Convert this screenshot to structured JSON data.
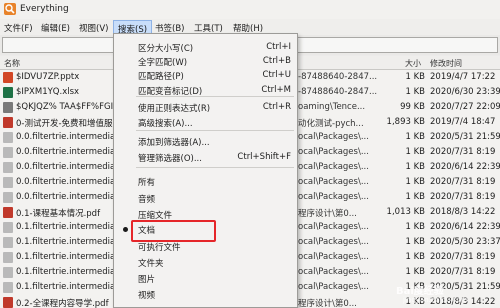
{
  "window": {
    "title": "Everything"
  },
  "menubar": [
    {
      "id": "file",
      "label": "文件(F)"
    },
    {
      "id": "edit",
      "label": "编辑(E)"
    },
    {
      "id": "view",
      "label": "视图(V)"
    },
    {
      "id": "search",
      "label": "搜索(S)"
    },
    {
      "id": "bookmarks",
      "label": "书签(B)"
    },
    {
      "id": "tools",
      "label": "工具(T)"
    },
    {
      "id": "help",
      "label": "帮助(H)"
    }
  ],
  "search": {
    "value": "",
    "placeholder": ""
  },
  "columns": {
    "name": "名称",
    "size": "大小",
    "modified": "修改时间"
  },
  "files": [
    {
      "name": "$IDVU7ZP.pptx",
      "path": "-87488640-2847...",
      "size": "1 KB",
      "date": "2019/4/7 17:22",
      "color": "#d24726"
    },
    {
      "name": "$IPXM1YQ.xlsx",
      "path": "-87488640-2847...",
      "size": "1 KB",
      "date": "2020/6/30 23:39",
      "color": "#1e7145"
    },
    {
      "name": "$QKJQZ% TAA$FF%FGIF",
      "path": "oaming\\Tence...",
      "size": "99 KB",
      "date": "2020/7/27 22:09",
      "color": "#7a7a7a"
    },
    {
      "name": "0-测试开发-免费和增值服",
      "path": "动化测试-pych...",
      "size": "1,893 KB",
      "date": "2019/7/4 18:47",
      "color": "#c0392b"
    },
    {
      "name": "0.0.filtertrie.intermediate",
      "path": "ocal\\Packages\\...",
      "size": "1 KB",
      "date": "2020/5/31 21:59",
      "color": "#b9b9b9"
    },
    {
      "name": "0.0.filtertrie.intermediate",
      "path": "ocal\\Packages\\...",
      "size": "1 KB",
      "date": "2020/7/31 8:19",
      "color": "#b9b9b9"
    },
    {
      "name": "0.0.filtertrie.intermediate",
      "path": "ocal\\Packages\\...",
      "size": "1 KB",
      "date": "2020/6/14 22:39",
      "color": "#b9b9b9"
    },
    {
      "name": "0.0.filtertrie.intermediate",
      "path": "ocal\\Packages\\...",
      "size": "1 KB",
      "date": "2020/7/31 8:19",
      "color": "#b9b9b9"
    },
    {
      "name": "0.0.filtertrie.intermediate",
      "path": "ocal\\Packages\\...",
      "size": "1 KB",
      "date": "2020/7/31 8:19",
      "color": "#b9b9b9"
    },
    {
      "name": "0.1-课程基本情况.pdf",
      "path": "程序设计\\第0...",
      "size": "1,013 KB",
      "date": "2018/8/3 14:22",
      "color": "#c0392b"
    },
    {
      "name": "0.1.filtertrie.intermediate",
      "path": "ocal\\Packages\\...",
      "size": "1 KB",
      "date": "2020/6/14 22:39",
      "color": "#b9b9b9"
    },
    {
      "name": "0.1.filtertrie.intermediate",
      "path": "ocal\\Packages\\...",
      "size": "1 KB",
      "date": "2020/5/30 23:37",
      "color": "#b9b9b9"
    },
    {
      "name": "0.1.filtertrie.intermediate",
      "path": "ocal\\Packages\\...",
      "size": "1 KB",
      "date": "2020/7/31 8:19",
      "color": "#b9b9b9"
    },
    {
      "name": "0.1.filtertrie.intermediate",
      "path": "ocal\\Packages\\...",
      "size": "1 KB",
      "date": "2020/7/31 8:19",
      "color": "#b9b9b9"
    },
    {
      "name": "0.1.filtertrie.intermediate",
      "path": "ocal\\Packages\\...",
      "size": "1 KB",
      "date": "2020/5/31 21:59",
      "color": "#b9b9b9"
    },
    {
      "name": "0.2-全课程内容导学.pdf",
      "path": "程序设计\\第0...",
      "size": "1 KB",
      "date": "2018/8/3 14:22",
      "color": "#c0392b"
    }
  ],
  "search_menu": {
    "items": [
      {
        "label": "区分大小写(C)",
        "shortcut": "Ctrl+I"
      },
      {
        "label": "全字匹配(W)",
        "shortcut": "Ctrl+B"
      },
      {
        "label": "匹配路径(P)",
        "shortcut": "Ctrl+U"
      },
      {
        "label": "匹配变音标记(D)",
        "shortcut": "Ctrl+M"
      },
      {
        "label": "使用正则表达式(R)",
        "shortcut": "Ctrl+R"
      },
      {
        "label": "高级搜索(A)...",
        "shortcut": ""
      },
      {
        "label": "添加到筛选器(A)...",
        "shortcut": ""
      },
      {
        "label": "管理筛选器(O)...",
        "shortcut": "Ctrl+Shift+F"
      },
      {
        "label": "所有",
        "shortcut": ""
      },
      {
        "label": "音频",
        "shortcut": ""
      },
      {
        "label": "压缩文件",
        "shortcut": ""
      },
      {
        "label": "文档",
        "shortcut": "",
        "checked": true
      },
      {
        "label": "可执行文件",
        "shortcut": ""
      },
      {
        "label": "文件夹",
        "shortcut": ""
      },
      {
        "label": "图片",
        "shortcut": ""
      },
      {
        "label": "视频",
        "shortcut": ""
      }
    ]
  },
  "watermark": {
    "line1": "Bai度经验",
    "line2": "jingyan.baidu.com"
  },
  "colors": {
    "menu_active": "#c9defa",
    "highlight_box": "#e5262a"
  }
}
